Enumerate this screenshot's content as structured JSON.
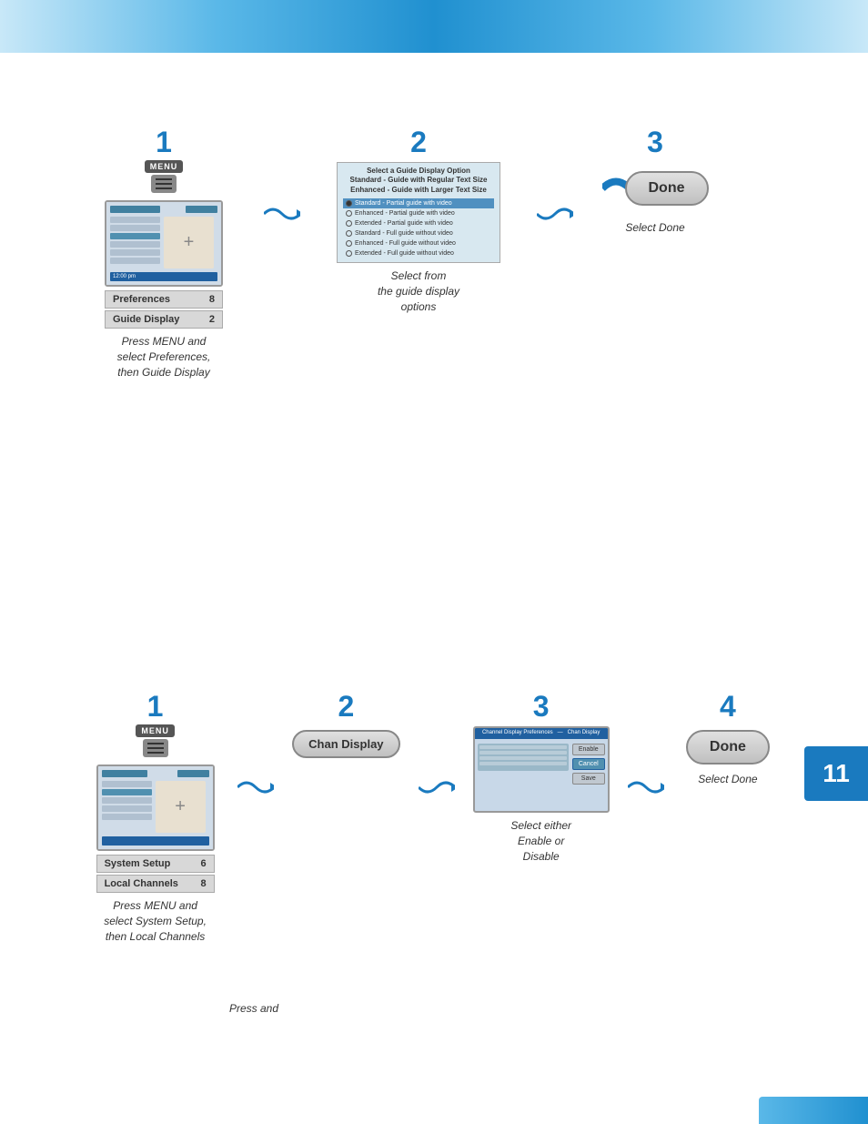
{
  "page": {
    "chapter": "11",
    "top_banner_alt": "Blue header banner"
  },
  "section1": {
    "steps": [
      {
        "num": "1",
        "icon": "MENU",
        "caption_line1": "Press MENU and",
        "caption_line2": "select Preferences,",
        "caption_line3": "then Guide Display"
      },
      {
        "num": "2",
        "panel_title": "Select a Guide Display Option\nStandard - Guide with Regular Text Size\nEnhanced - Guide with Larger Text Size",
        "options": [
          {
            "label": "Standard - Partial guide with video",
            "selected": true
          },
          {
            "label": "Enhanced - Partial guide with video",
            "selected": false
          },
          {
            "label": "Extended - Partial guide with video",
            "selected": false
          },
          {
            "label": "Standard - Full guide without video",
            "selected": false
          },
          {
            "label": "Enhanced - Full guide without video",
            "selected": false
          },
          {
            "label": "Extended - Full guide without video",
            "selected": false
          }
        ],
        "caption_line1": "Select from",
        "caption_line2": "the guide display",
        "caption_line3": "options"
      },
      {
        "num": "3",
        "button_label": "Done",
        "caption": "Select Done"
      }
    ],
    "label1": "Preferences",
    "label1_num": "8",
    "label2": "Guide Display",
    "label2_num": "2"
  },
  "section2": {
    "steps": [
      {
        "num": "1",
        "icon": "MENU",
        "caption_line1": "Press MENU and",
        "caption_line2": "select System Setup,",
        "caption_line3": "then Local Channels"
      },
      {
        "num": "2",
        "button_label": "Chan Display"
      },
      {
        "num": "3",
        "screen_title": "Channel Display Preferences",
        "caption_line1": "Select either",
        "caption_line2": "Enable or",
        "caption_line3": "Disable"
      },
      {
        "num": "4",
        "button_label": "Done",
        "caption": "Select Done"
      }
    ],
    "label1": "System Setup",
    "label1_num": "6",
    "label2": "Local Channels",
    "label2_num": "8"
  },
  "press_and": "Press and"
}
